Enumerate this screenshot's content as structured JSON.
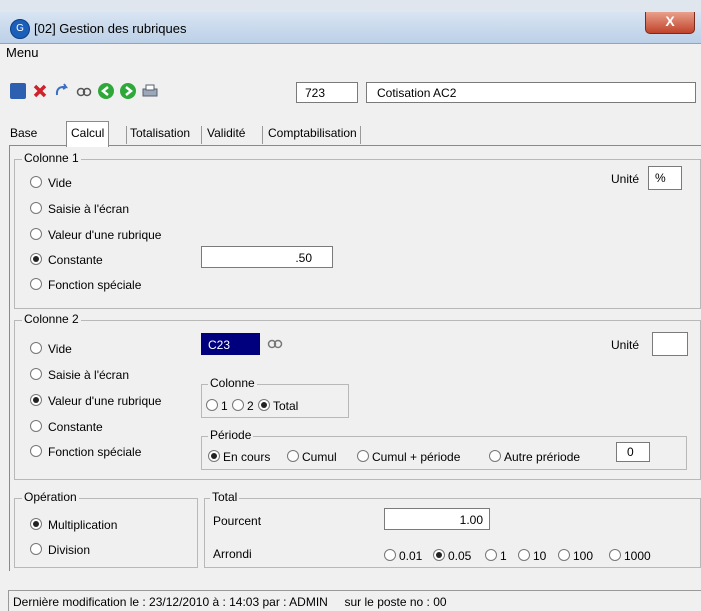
{
  "window": {
    "title": "[02]  Gestion des rubriques",
    "close_glyph": "X"
  },
  "menu": {
    "label": "Menu"
  },
  "toolbar": {
    "icons": [
      "save-icon",
      "delete-icon",
      "refresh-icon",
      "view-icon",
      "back-icon",
      "forward-icon",
      "print-icon"
    ],
    "code_value": "723",
    "name_value": "Cotisation AC2"
  },
  "tabs": [
    "Base",
    "Calcul",
    "Totalisation",
    "Validité",
    "Comptabilisation"
  ],
  "colonne1": {
    "legend": "Colonne 1",
    "unite_label": "Unité",
    "unite_value": "%",
    "options": [
      "Vide",
      "Saisie à l'écran",
      "Valeur d'une rubrique",
      "Constante",
      "Fonction spéciale"
    ],
    "selected": "Constante",
    "constante_value": ".50"
  },
  "colonne2": {
    "legend": "Colonne 2",
    "unite_label": "Unité",
    "unite_value": "",
    "options": [
      "Vide",
      "Saisie à l'écran",
      "Valeur d'une rubrique",
      "Constante",
      "Fonction spéciale"
    ],
    "selected": "Valeur d'une rubrique",
    "rubrique_value": "C23",
    "colonne_group": {
      "legend": "Colonne",
      "options": [
        "1",
        "2",
        "Total"
      ],
      "selected": "Total"
    },
    "periode_group": {
      "legend": "Période",
      "options": [
        "En cours",
        "Cumul",
        "Cumul + période",
        "Autre prériode"
      ],
      "selected": "En cours",
      "autre_value": "0"
    }
  },
  "operation": {
    "legend": "Opération",
    "options": [
      "Multiplication",
      "Division"
    ],
    "selected": "Multiplication"
  },
  "total": {
    "legend": "Total",
    "pourcent_label": "Pourcent",
    "pourcent_value": "1.00",
    "arrondi_label": "Arrondi",
    "arrondi_options": [
      "0.01",
      "0.05",
      "1",
      "10",
      "100",
      "1000"
    ],
    "arrondi_selected": "0.05"
  },
  "status": {
    "text": "Dernière modification le : 23/12/2010 à : 14:03 par : ADMIN     sur le poste no : 00"
  },
  "colors": {
    "rubrique_bg": "#00007f",
    "titlebar": "#c7d8ec"
  }
}
